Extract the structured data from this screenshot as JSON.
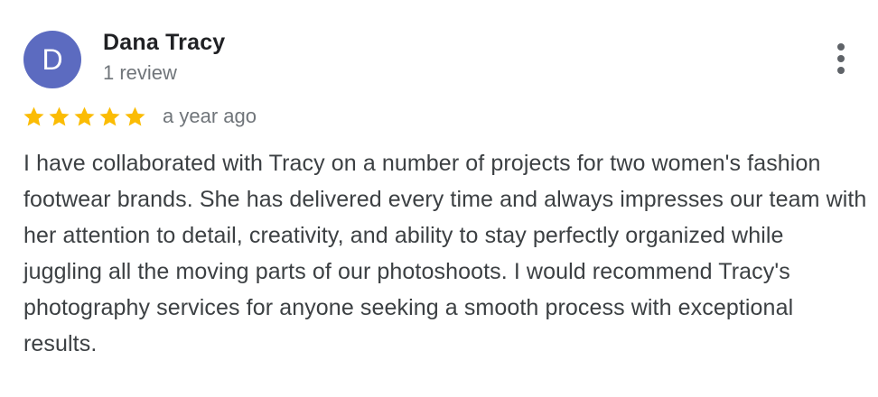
{
  "reviewer": {
    "avatar_letter": "D",
    "avatar_color": "#5c6bc0",
    "name": "Dana Tracy",
    "review_count": "1 review"
  },
  "menu": {
    "icon": "more-vert-icon"
  },
  "rating": {
    "stars": 5,
    "max_stars": 5,
    "star_color": "#fbbc04",
    "timestamp": "a year ago"
  },
  "review": {
    "text": "I have collaborated with Tracy on a number of projects for two women's fashion footwear brands. She has delivered every time and always impresses our team with her attention to detail, creativity, and ability to stay perfectly organized while juggling all the moving parts of our photoshoots. I would recommend Tracy's photography services for anyone seeking a smooth process with exceptional results."
  }
}
